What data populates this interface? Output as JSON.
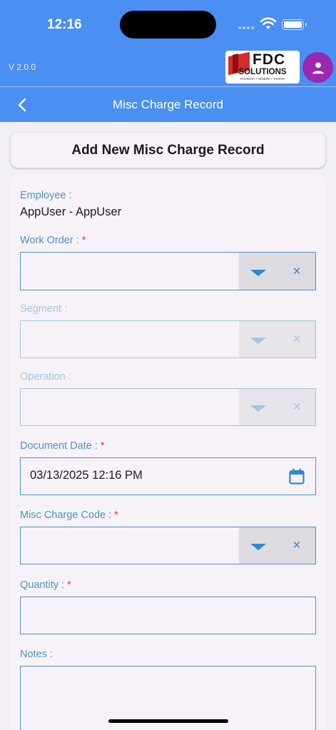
{
  "status": {
    "time": "12:16"
  },
  "header": {
    "version": "V 2.0.0",
    "logo_main": "FDC",
    "logo_sub": "SOLUTIONS",
    "logo_tagline": "envision • enable • evolve",
    "title": "Misc Charge Record"
  },
  "form": {
    "heading": "Add New Misc Charge Record",
    "employee": {
      "label": "Employee :",
      "value": "AppUser - AppUser"
    },
    "work_order": {
      "label": "Work Order :",
      "required": "*",
      "value": ""
    },
    "segment": {
      "label": "Segment :",
      "value": ""
    },
    "operation": {
      "label": "Operation :",
      "value": ""
    },
    "document_date": {
      "label": "Document Date :",
      "required": "*",
      "value": "03/13/2025 12:16 PM"
    },
    "misc_charge_code": {
      "label": "Misc Charge Code :",
      "required": "*",
      "value": ""
    },
    "quantity": {
      "label": "Quantity :",
      "required": "*",
      "value": ""
    },
    "notes": {
      "label": "Notes :",
      "value": ""
    }
  },
  "icons": {
    "dropdown": "triangle-down",
    "clear": "×",
    "back": "chevron-left",
    "calendar": "calendar-icon",
    "avatar": "person-icon"
  },
  "colors": {
    "header_bg": "#4a8ff1",
    "accent": "#4e92c8",
    "avatar_bg": "#9b28b0",
    "required": "#e53935"
  }
}
